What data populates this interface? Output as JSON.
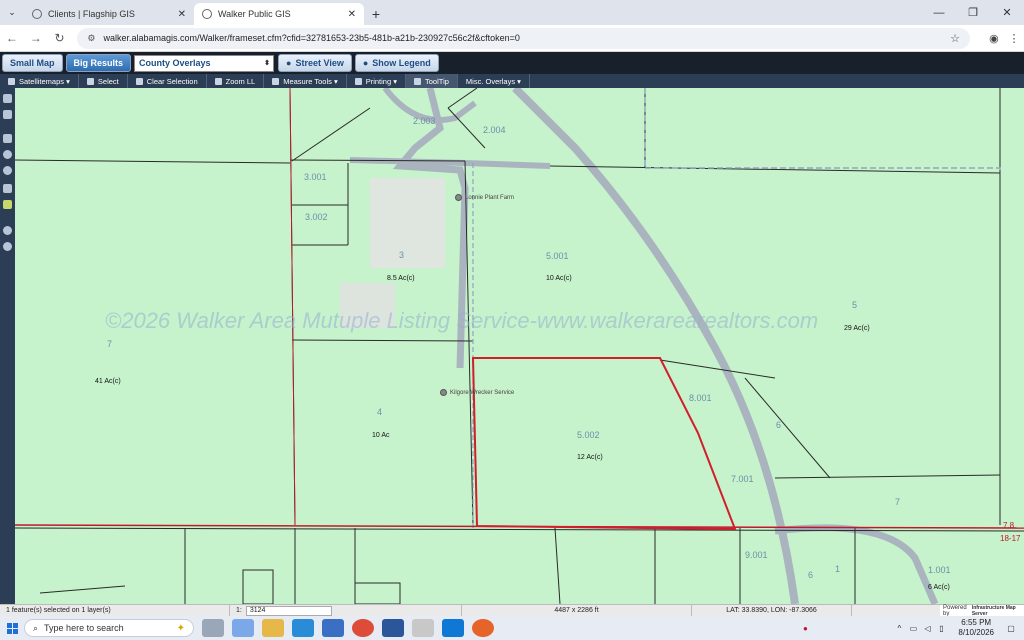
{
  "browser": {
    "tabs": [
      {
        "title": "Clients | Flagship GIS",
        "active": false
      },
      {
        "title": "Walker Public GIS",
        "active": true
      }
    ],
    "url": "walker.alabamagis.com/Walker/frameset.cfm?cfid=32781653-23b5-481b-a21b-230927c56c2f&cftoken=0"
  },
  "app_toolbar": {
    "small_map": "Small Map",
    "big_results": "Big Results",
    "overlay_select": "County Overlays",
    "street_view": "Street View",
    "show_legend": "Show Legend"
  },
  "map_toolbar": {
    "basemap": "Satellitemaps",
    "select": "Select",
    "clear_selection": "Clear Selection",
    "zoom_ll": "Zoom LL",
    "measure_tools": "Measure Tools",
    "printing": "Printing",
    "tooltip": "ToolTip",
    "misc_overlays": "Misc. Overlays"
  },
  "map": {
    "watermark": "©2026 Walker Area Mutuple Listing Service-www.walkerarearealtors.com",
    "parcels": [
      {
        "id": "2.003"
      },
      {
        "id": "2.004"
      },
      {
        "id": "3.001"
      },
      {
        "id": "3.002"
      },
      {
        "id": "3",
        "acres": "8.5 Ac(c)"
      },
      {
        "id": "5.001",
        "acres": "10 Ac(c)"
      },
      {
        "id": "5",
        "acres": "29 Ac(c)"
      },
      {
        "id": "7",
        "acres": "41 Ac(c)"
      },
      {
        "id": "4",
        "acres": "10 Ac"
      },
      {
        "id": "5.002",
        "acres": "12 Ac(c)"
      },
      {
        "id": "8.001"
      },
      {
        "id": "6"
      },
      {
        "id": "7.001"
      },
      {
        "id": "7"
      },
      {
        "id": "9.001"
      },
      {
        "id": "6"
      },
      {
        "id": "1"
      },
      {
        "id": "1.001",
        "acres": "6 Ac(c)"
      }
    ],
    "pois": [
      "Lonnie Plant Farm",
      "Kilgore Wrecker Service"
    ],
    "corner_labels": [
      "7.8",
      "18-17"
    ]
  },
  "status": {
    "selection": "1 feature(s) selected on 1 layer(s)",
    "scale_prefix": "1:",
    "scale": "3124",
    "extent": "4487 x 2286 ft",
    "coords": "LAT: 33.8390, LON: -87.3066",
    "powered_by": "Powered by",
    "provider": "Infrastructure Map Server"
  },
  "taskbar": {
    "search_placeholder": "Type here to search",
    "time": "6:55 PM",
    "date": "8/10/2026"
  }
}
